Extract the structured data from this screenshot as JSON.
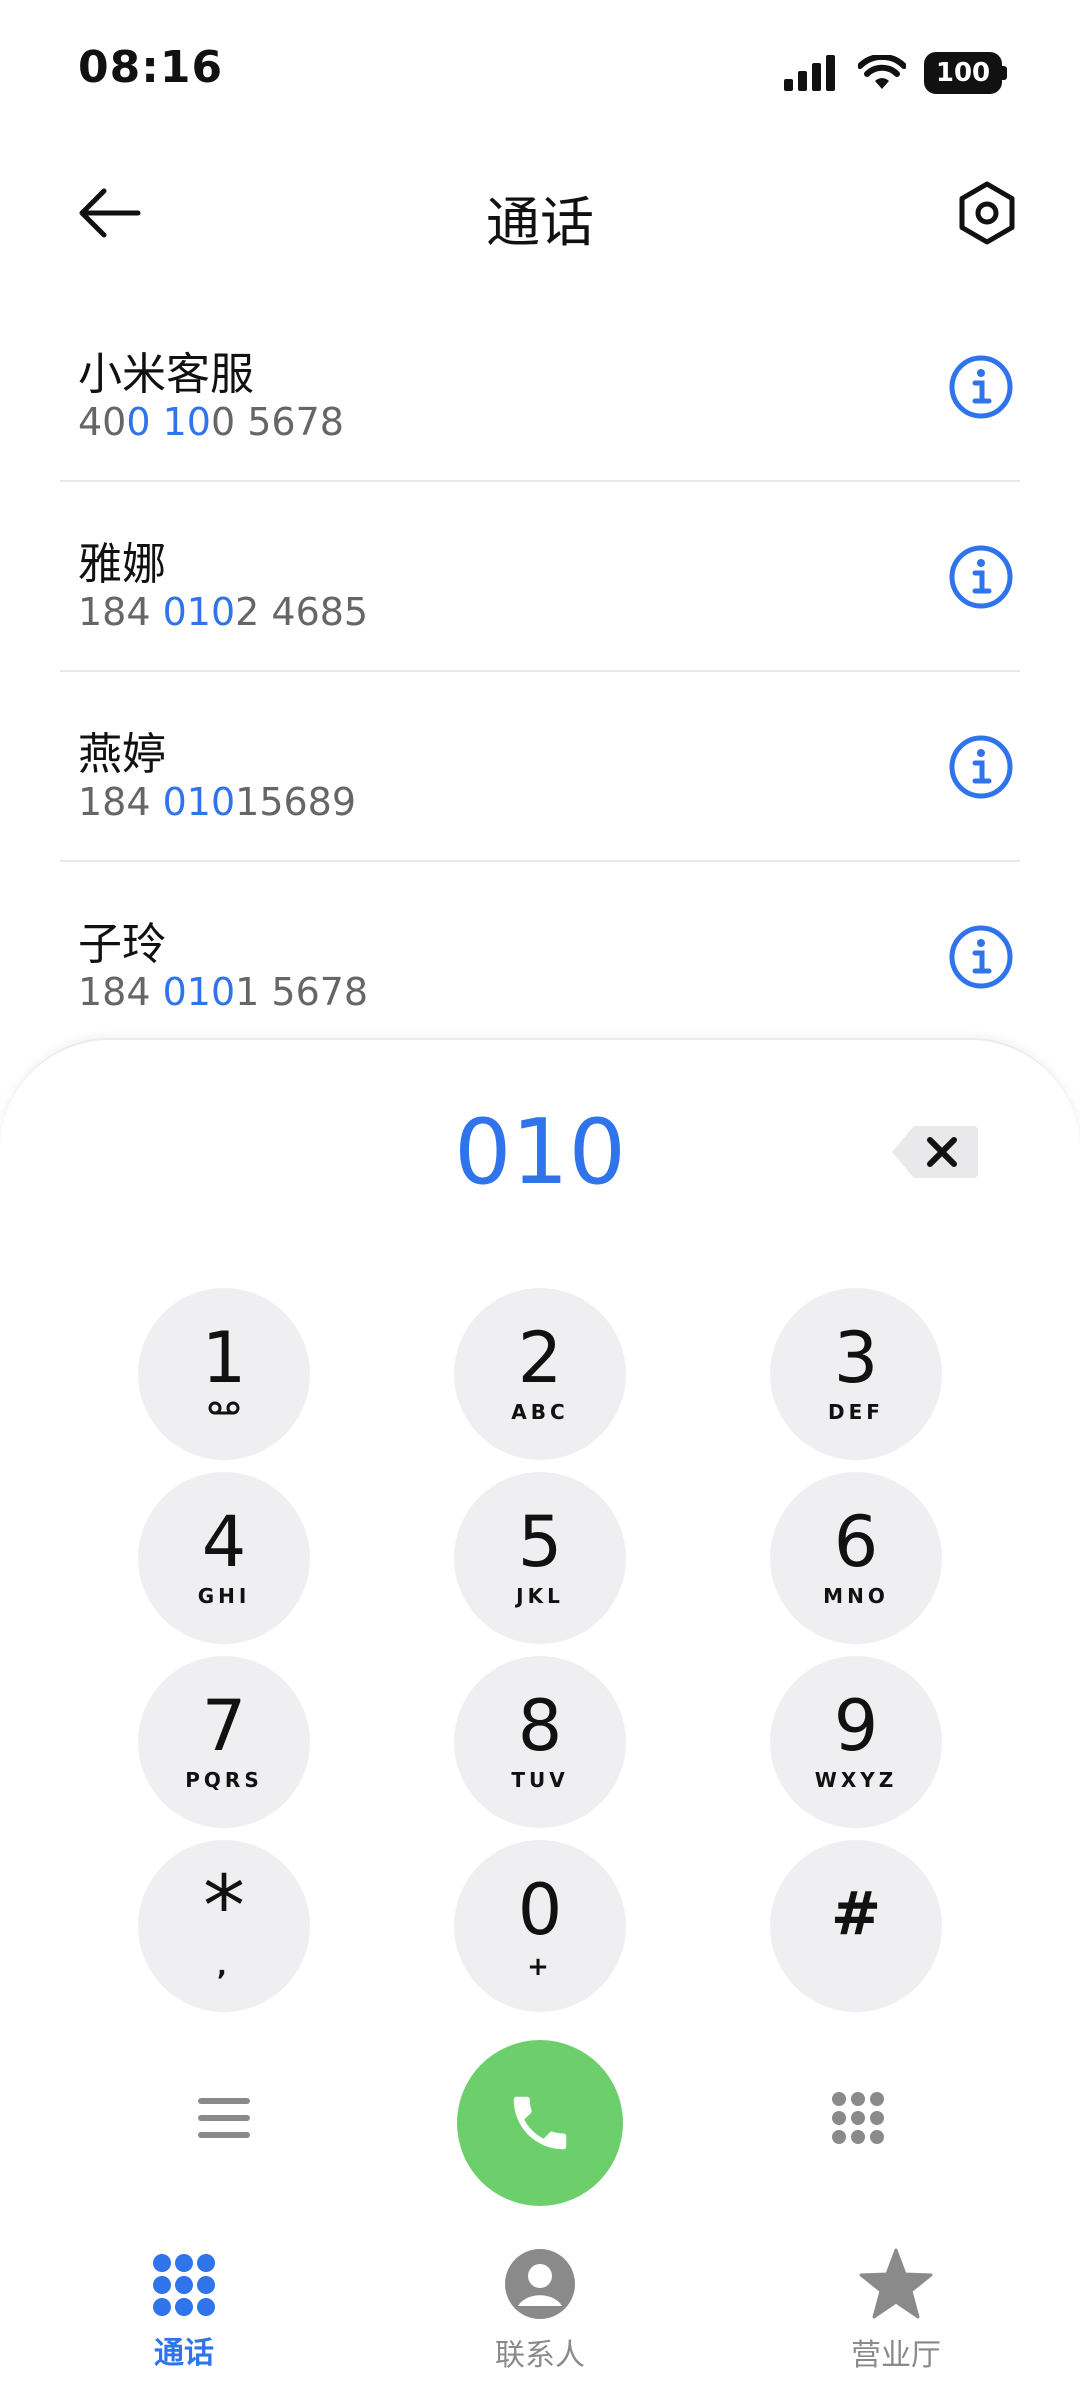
{
  "status_bar": {
    "time": "08:16",
    "battery": "100"
  },
  "header": {
    "title": "通话"
  },
  "contacts": [
    {
      "name": "小米客服",
      "number_parts": [
        "40",
        "0 10",
        "0 5678"
      ]
    },
    {
      "name": "雅娜",
      "number_parts": [
        "184 ",
        "010",
        "2 4685"
      ]
    },
    {
      "name": "燕婷",
      "number_parts": [
        "184 ",
        "010",
        "15689"
      ]
    },
    {
      "name": "子玲",
      "number_parts": [
        "184 ",
        "010",
        "1 5678"
      ]
    }
  ],
  "dialpad": {
    "input": "010",
    "keys": [
      {
        "digit": "1",
        "letters": ""
      },
      {
        "digit": "2",
        "letters": "ABC"
      },
      {
        "digit": "3",
        "letters": "DEF"
      },
      {
        "digit": "4",
        "letters": "GHI"
      },
      {
        "digit": "5",
        "letters": "JKL"
      },
      {
        "digit": "6",
        "letters": "MNO"
      },
      {
        "digit": "7",
        "letters": "PQRS"
      },
      {
        "digit": "8",
        "letters": "TUV"
      },
      {
        "digit": "9",
        "letters": "WXYZ"
      },
      {
        "digit": "*",
        "letters": ","
      },
      {
        "digit": "0",
        "letters": "+"
      },
      {
        "digit": "#",
        "letters": ""
      }
    ]
  },
  "bottom_nav": {
    "items": [
      {
        "label": "通话",
        "icon": "dialpad-icon",
        "active": true
      },
      {
        "label": "联系人",
        "icon": "contact-person-icon",
        "active": false
      },
      {
        "label": "营业厅",
        "icon": "star-icon",
        "active": false
      }
    ]
  },
  "colors": {
    "accent": "#2f74ea",
    "call": "#6ccf6c",
    "key_bg": "#efeff1",
    "inactive": "#8a8a8a"
  }
}
